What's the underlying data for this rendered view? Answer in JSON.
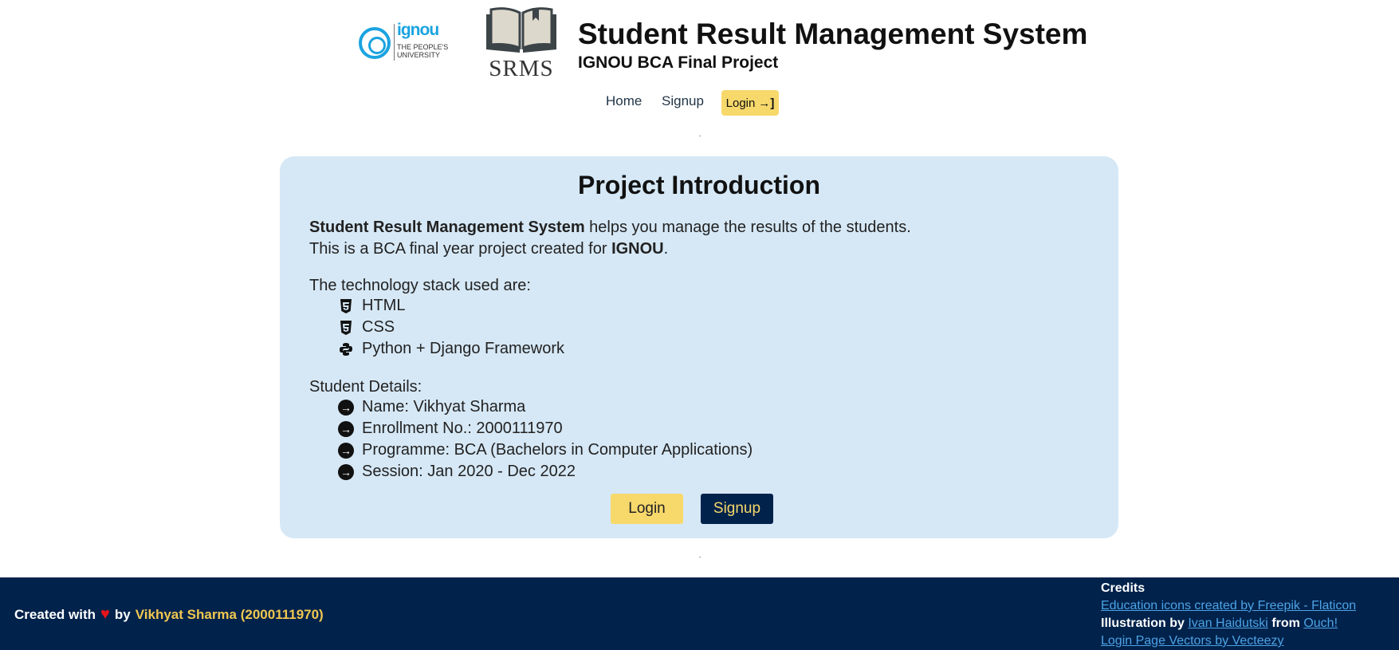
{
  "header": {
    "ignou_logo": {
      "name": "ignou",
      "line1": "THE PEOPLE'S",
      "line2": "UNIVERSITY"
    },
    "srms_logo_text": "SRMS",
    "title": "Student Result Management System",
    "subtitle": "IGNOU BCA Final Project"
  },
  "nav": {
    "home": "Home",
    "signup": "Signup",
    "login": "Login"
  },
  "card": {
    "title": "Project Introduction",
    "intro_bold": "Student Result Management System",
    "intro_rest": " helps you manage the results of the students.",
    "line2_pre": "This is a BCA final year project created for ",
    "line2_bold": "IGNOU",
    "line2_post": ".",
    "tech_heading": "The technology stack used are:",
    "tech": [
      "HTML",
      "CSS",
      "Python + Django Framework"
    ],
    "details_heading": "Student Details:",
    "details": [
      "Name: Vikhyat Sharma",
      "Enrollment No.: 2000111970",
      "Programme: BCA (Bachelors in Computer Applications)",
      "Session: Jan 2020 - Dec 2022"
    ],
    "login_button": "Login",
    "signup_button": "Signup"
  },
  "footer": {
    "created_with": "Created with",
    "by": "by",
    "author": "Vikhyat Sharma (2000111970)",
    "credits_heading": "Credits",
    "credit1": "Education icons created by Freepik - Flaticon",
    "illustration_by": "Illustration by",
    "ivan": "Ivan Haidutski",
    "from": "from",
    "ouch": "Ouch!",
    "credit3": "Login Page Vectors by Vecteezy"
  },
  "colors": {
    "accent": "#f7d86b",
    "navy": "#00224b",
    "card": "#d6e8f6",
    "link": "#4ea3e6"
  }
}
